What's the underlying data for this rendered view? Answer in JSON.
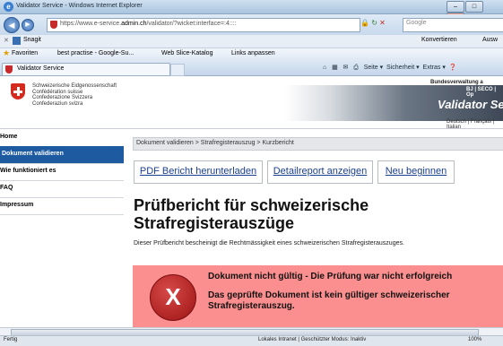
{
  "browser": {
    "window_title": "Validator Service - Windows Internet Explorer",
    "url_prefix": "https://www.e-service.",
    "url_domain": "admin.ch",
    "url_suffix": "/validator/?wicket:interface=:4::::",
    "search_placeholder": "Google",
    "snagit_label": "Snagit",
    "convert_label": "Konvertieren",
    "convert_more": "Ausw",
    "favorites_label": "Favoriten",
    "favorites": [
      "best practise - Google-Su...",
      "Web Slice-Katalog",
      "Links anpassen"
    ],
    "tab_title": "Validator Service",
    "command_items": [
      "Seite",
      "Sicherheit",
      "Extras"
    ]
  },
  "header": {
    "confed_lines": [
      "Schweizerische Eidgenossenschaft",
      "Confédération suisse",
      "Confederazione Svizzera",
      "Confederaziun svizra"
    ],
    "dept_line1": "Bundesverwaltung a",
    "dept_line2": "BJ | SECO | Op",
    "service_title": "Validator Ser",
    "languages": "Deutsch | Français | Italian"
  },
  "nav": {
    "items": [
      "Home",
      "Dokument validieren",
      "Wie funktioniert es",
      "FAQ",
      "Impressum"
    ],
    "active_index": 1
  },
  "main": {
    "breadcrumb": "Dokument validieren > Strafregisterauszug > Kurzbericht",
    "buttons": [
      "PDF Bericht herunterladen",
      "Detailreport anzeigen",
      "Neu beginnen"
    ],
    "heading": "Prüfbericht für schweizerische Strafregisterauszüge",
    "description": "Dieser Prüfbericht bescheinigt die Rechtmässigkeit eines schweizerischen Strafregisterauszuges.",
    "error_symbol": "X",
    "error_title": "Dokument nicht gültig - Die Prüfung war nicht erfolgreich",
    "error_text": "Das geprüfte Dokument ist kein gültiger schweizerischer Strafregisterauszug."
  },
  "statusbar": {
    "left": "Fertig",
    "zone": "Lokales Intranet | Geschützter Modus: Inaktiv",
    "zoom": "100%"
  },
  "colors": {
    "nav_active": "#1e5aa0",
    "error_bg": "#fb8f8f",
    "swiss_red": "#d52b1e"
  }
}
